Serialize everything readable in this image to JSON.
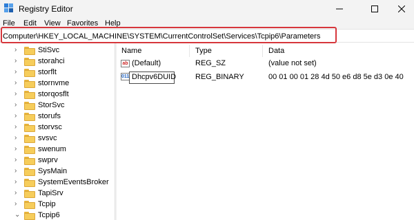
{
  "window": {
    "title": "Registry Editor",
    "minimize_glyph": "—",
    "maximize_glyph": "☐",
    "close_glyph": "✕"
  },
  "menu": [
    "File",
    "Edit",
    "View",
    "Favorites",
    "Help"
  ],
  "address": {
    "path": "Computer\\HKEY_LOCAL_MACHINE\\SYSTEM\\CurrentControlSet\\Services\\Tcpip6\\Parameters",
    "highlight_color": "#d6363b"
  },
  "tree": {
    "items": [
      {
        "label": "StiSvc",
        "expanded": false
      },
      {
        "label": "storahci",
        "expanded": false
      },
      {
        "label": "storflt",
        "expanded": false
      },
      {
        "label": "stornvme",
        "expanded": false
      },
      {
        "label": "storqosflt",
        "expanded": false
      },
      {
        "label": "StorSvc",
        "expanded": false
      },
      {
        "label": "storufs",
        "expanded": false
      },
      {
        "label": "storvsc",
        "expanded": false
      },
      {
        "label": "svsvc",
        "expanded": false
      },
      {
        "label": "swenum",
        "expanded": false
      },
      {
        "label": "swprv",
        "expanded": false
      },
      {
        "label": "SysMain",
        "expanded": false
      },
      {
        "label": "SystemEventsBroker",
        "expanded": false
      },
      {
        "label": "TapiSrv",
        "expanded": false
      },
      {
        "label": "Tcpip",
        "expanded": false
      },
      {
        "label": "Tcpip6",
        "expanded": true
      }
    ],
    "collapsed_glyph": "›",
    "expanded_glyph": "⌄"
  },
  "list": {
    "columns": {
      "name": "Name",
      "type": "Type",
      "data": "Data"
    },
    "rows": [
      {
        "name": "(Default)",
        "type": "REG_SZ",
        "data": "(value not set)",
        "icon": "string-value-icon",
        "icon_text": "ab"
      },
      {
        "name": "Dhcpv6DUID",
        "type": "REG_BINARY",
        "data": "00 01 00 01 28 4d 50 e6 d8 5e d3 0e 40 e0",
        "icon": "binary-value-icon",
        "icon_text": "011"
      }
    ]
  }
}
